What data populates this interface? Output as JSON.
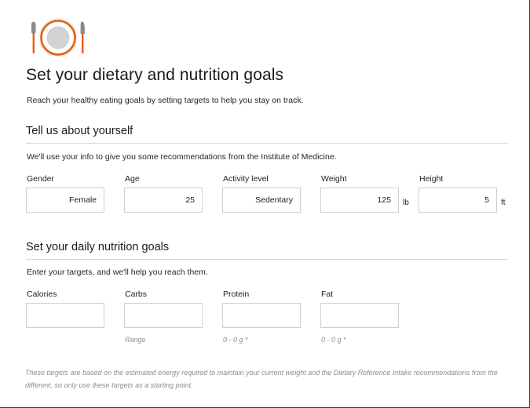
{
  "header": {
    "icon_name": "plate-fork-knife-icon",
    "title": "Set your dietary and nutrition goals",
    "subtitle": "Reach your healthy eating goals by setting targets to help you stay on track."
  },
  "colors": {
    "accent_orange": "#E8600D",
    "plate_gray": "#D2D2D2",
    "utensil_gray": "#808080",
    "rule_gray": "#D4D4D4",
    "input_border": "#CFCFCF",
    "hint_gray": "#8C8C8C",
    "text": "#1B1B1B"
  },
  "sections": [
    {
      "title": "Tell us about yourself",
      "description": "We'll use your info to give you some recommendations from the Institute of Medicine.",
      "fields": [
        {
          "label": "Gender",
          "value": "Female",
          "unit": "",
          "hint": ""
        },
        {
          "label": "Age",
          "value": "25",
          "unit": "",
          "hint": ""
        },
        {
          "label": "Activity level",
          "value": "Sedentary",
          "unit": "",
          "hint": ""
        },
        {
          "label": "Weight",
          "value": "125",
          "unit": "lb",
          "hint": ""
        },
        {
          "label": "Height",
          "value": "5",
          "unit": "ft",
          "hint": ""
        }
      ]
    },
    {
      "title": "Set your daily nutrition goals",
      "description": "Enter your targets, and we'll help you reach them.",
      "fields": [
        {
          "label": "Calories",
          "value": "",
          "unit": "",
          "hint": ""
        },
        {
          "label": "Carbs",
          "value": "",
          "unit": "",
          "hint": "Range"
        },
        {
          "label": "Protein",
          "value": "",
          "unit": "",
          "hint": "0 - 0 g *"
        },
        {
          "label": "Fat",
          "value": "",
          "unit": "",
          "hint": "0 - 0 g *"
        }
      ]
    }
  ],
  "footnote": "These targets are based on the estimated energy required to maintain your current weight and the Dietary Reference Intake recommendations from the different, so only use these targets as a starting point."
}
